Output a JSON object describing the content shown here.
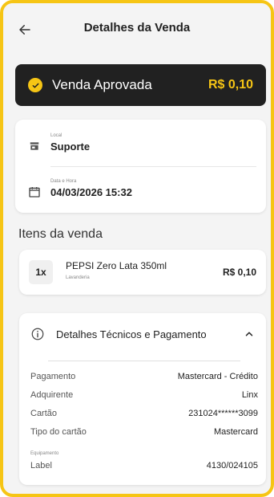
{
  "header": {
    "title": "Detalhes da Venda"
  },
  "status": {
    "label": "Venda Aprovada",
    "amount": "R$ 0,10"
  },
  "info": {
    "location_label": "Local",
    "location_value": "Suporte",
    "datetime_label": "Data e Hora",
    "datetime_value": "04/03/2026 15:32"
  },
  "items_section": {
    "title": "Itens da venda",
    "items": [
      {
        "qty": "1x",
        "name": "PEPSI Zero Lata 350ml",
        "category": "Lavanderia",
        "price": "R$ 0,10"
      }
    ]
  },
  "details": {
    "title": "Detalhes Técnicos e Pagamento",
    "rows": [
      {
        "key": "Pagamento",
        "value": "Mastercard - Crédito"
      },
      {
        "key": "Adquirente",
        "value": "Linx"
      },
      {
        "key": "Cartão",
        "value": "231024******3099"
      },
      {
        "key": "Tipo do cartão",
        "value": "Mastercard"
      }
    ],
    "equipment_small_label": "Equipamento",
    "equipment_key": "Label",
    "equipment_value": "4130/024105"
  },
  "colors": {
    "accent": "#f6c515",
    "dark": "#212121"
  }
}
